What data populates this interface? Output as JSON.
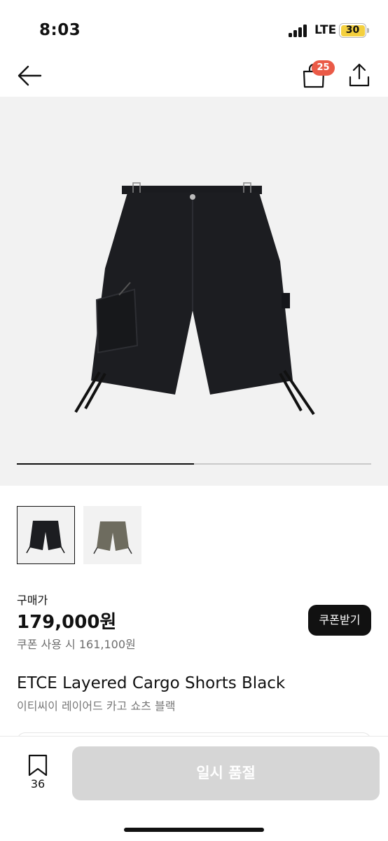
{
  "status_bar": {
    "time": "8:03",
    "network": "LTE",
    "battery": "30",
    "icons": [
      "signal-bars-icon",
      "battery-icon"
    ]
  },
  "nav": {
    "icons": [
      "back-arrow-icon",
      "shopping-bag-icon",
      "share-icon"
    ],
    "cart_count": "25"
  },
  "gallery": {
    "slide_progress": 0.5,
    "image": "black-cargo-shorts"
  },
  "color_options": [
    {
      "name": "black",
      "color": "#1c1d21",
      "selected": true
    },
    {
      "name": "khaki",
      "color": "#6e6c5f",
      "selected": false
    }
  ],
  "pricing": {
    "label": "구매가",
    "price": "179,000원",
    "coupon_text": "쿠폰 사용 시 161,100원",
    "coupon_button": "쿠폰받기"
  },
  "product": {
    "name": "ETCE Layered Cargo Shorts Black",
    "name_ko": "이티씨이 레이어드 카고 쇼츠 블랙"
  },
  "bottom_bar": {
    "bookmark_icon": "bookmark-icon",
    "bookmark_count": "36",
    "soldout_label": "일시 품절"
  },
  "colors": {
    "accent_badge": "#ea5a47",
    "disabled_button": "#d6d6d6",
    "battery": "#f4d03f"
  }
}
